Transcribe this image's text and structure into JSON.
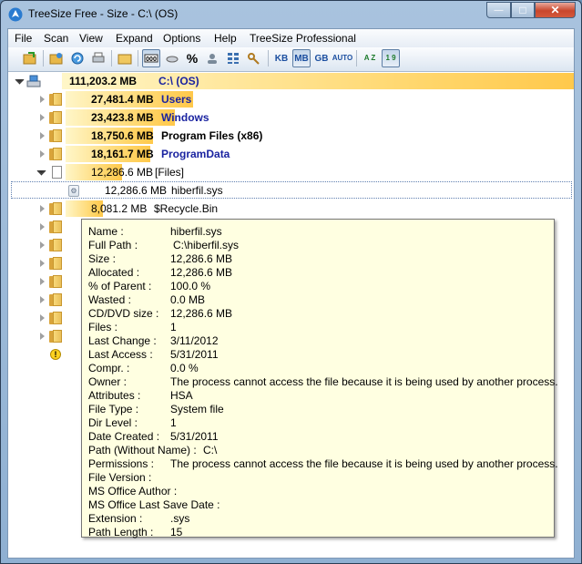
{
  "window": {
    "title": "TreeSize Free - Size - C:\\  (OS)",
    "caption_min": "—",
    "caption_max": "□",
    "caption_close": "✕"
  },
  "menu": [
    "File",
    "Scan",
    "View",
    "Expand",
    "Options",
    "Help",
    "TreeSize Professional"
  ],
  "toolbar": {
    "units": [
      "KB",
      "MB",
      "GB",
      "AUTO"
    ],
    "selected_unit": "MB",
    "percent_label": "%",
    "sort_az": "A Z",
    "sort_num": "1 9"
  },
  "tree": {
    "root": {
      "size": "111,203.2 MB",
      "name": "C:\\  (OS)",
      "fraction": 1.0
    },
    "items": [
      {
        "size": "27,481.4 MB",
        "name": "Users",
        "fraction": 0.247,
        "style": "blue"
      },
      {
        "size": "23,423.8 MB",
        "name": "Windows",
        "fraction": 0.211,
        "style": "blue"
      },
      {
        "size": "18,750.6 MB",
        "name": "Program Files (x86)",
        "fraction": 0.169,
        "style": "black"
      },
      {
        "size": "18,161.7 MB",
        "name": "ProgramData",
        "fraction": 0.163,
        "style": "blue"
      },
      {
        "size": "12,286.6 MB",
        "name": "[Files]",
        "fraction": 0.11,
        "style": "plain"
      }
    ],
    "selected": {
      "size": "12,286.6 MB",
      "name": "hiberfil.sys"
    },
    "recycle": {
      "size": "8,081.2 MB",
      "name": "$Recycle.Bin",
      "fraction": 0.073
    }
  },
  "tooltip": [
    {
      "label": "Name :",
      "value": "hiberfil.sys"
    },
    {
      "label": "Full Path :",
      "value": "C:\\hiberfil.sys"
    },
    {
      "label": "Size :",
      "value": "12,286.6 MB"
    },
    {
      "label": "Allocated :",
      "value": "12,286.6 MB"
    },
    {
      "label": "% of Parent :",
      "value": "100.0 %"
    },
    {
      "label": "Wasted :",
      "value": "0.0 MB"
    },
    {
      "label": "CD/DVD size :",
      "value": "12,286.6 MB"
    },
    {
      "label": "Files :",
      "value": "1"
    },
    {
      "label": "Last Change :",
      "value": "3/11/2012"
    },
    {
      "label": "Last Access :",
      "value": "5/31/2011"
    },
    {
      "label": "Compr. :",
      "value": "0.0 %"
    },
    {
      "label": "Owner :",
      "value": "The process cannot access the file because it is being used by another process."
    },
    {
      "label": "Attributes :",
      "value": "HSA"
    },
    {
      "label": "File Type :",
      "value": "System file"
    },
    {
      "label": "Dir Level :",
      "value": "1"
    },
    {
      "label": "Date Created :",
      "value": "5/31/2011"
    },
    {
      "label": "Path (Without Name) :",
      "value": "C:\\"
    },
    {
      "label": "Permissions :",
      "value": "The process cannot access the file because it is being used by another process."
    },
    {
      "label": "File Version :",
      "value": ""
    },
    {
      "label": "MS Office Author :",
      "value": ""
    },
    {
      "label": "MS Office Last Save Date :",
      "value": ""
    },
    {
      "label": "Extension :",
      "value": ".sys"
    },
    {
      "label": "Path Length :",
      "value": "15"
    }
  ],
  "colors": {
    "bar_end": "#ffc84a",
    "bar_start": "#fff6c8",
    "blue_text": "#1a23a0",
    "tooltip_bg": "#ffffe1"
  }
}
